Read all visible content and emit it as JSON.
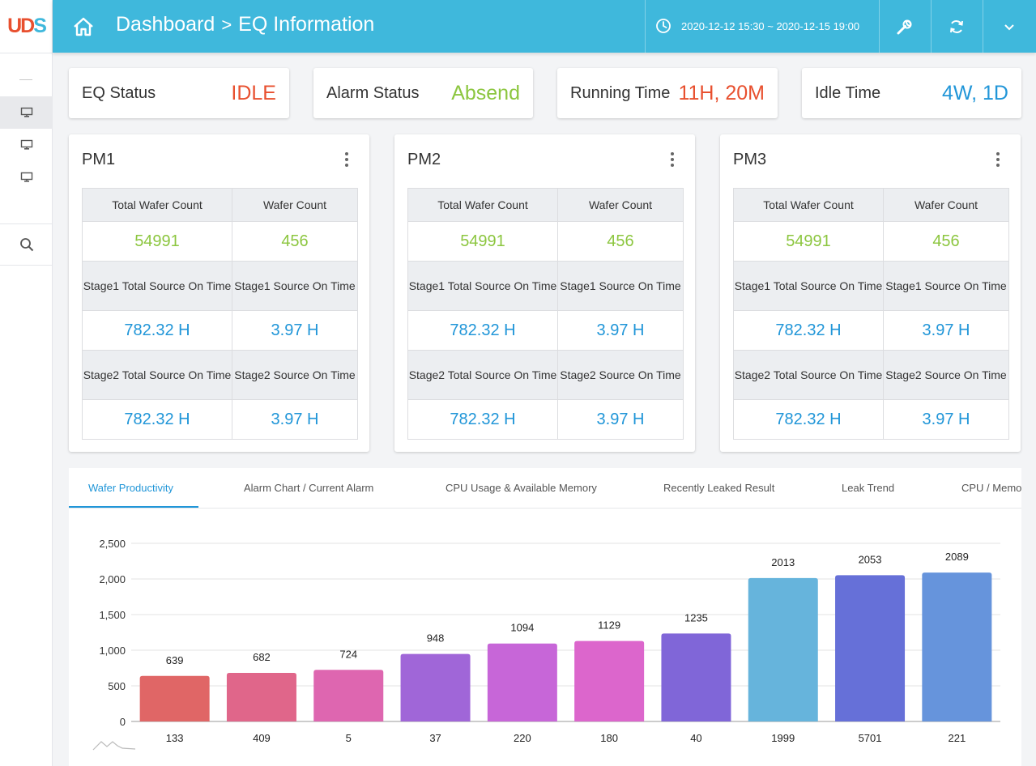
{
  "sidebar": {
    "logo": "UDS",
    "items": [
      {
        "icon": "monitor-icon",
        "active": true
      },
      {
        "icon": "monitor-icon",
        "active": false
      },
      {
        "icon": "monitor-icon",
        "active": false
      }
    ],
    "search_icon": "search-icon"
  },
  "header": {
    "crumb_root": "Dashboard",
    "crumb_separator": ">",
    "crumb_current": "EQ Information",
    "time_range": "2020-12-12 15:30 ~ 2020-12-15 19:00",
    "icons": [
      "home-icon",
      "clock-icon",
      "wrench-icon",
      "refresh-icon",
      "chevron-down-icon"
    ]
  },
  "status": [
    {
      "label": "EQ Status",
      "value": "IDLE",
      "color": "#e8502f"
    },
    {
      "label": "Alarm Status",
      "value": "Absend",
      "color": "#8cc63f"
    },
    {
      "label": "Running Time",
      "value": "11H, 20M",
      "color": "#e8502f"
    },
    {
      "label": "Idle Time",
      "value": "4W, 1D",
      "color": "#2196d8"
    }
  ],
  "pm_cards": [
    {
      "title": "PM1",
      "headers": [
        "Total Wafer Count",
        "Wafer Count",
        "Stage1 Total Source On Time",
        "Stage1 Source On Time",
        "Stage2 Total Source On Time",
        "Stage2 Source On Time"
      ],
      "values": [
        "54991",
        "456",
        "782.32 H",
        "3.97 H",
        "782.32 H",
        "3.97 H"
      ]
    },
    {
      "title": "PM2",
      "headers": [
        "Total Wafer Count",
        "Wafer Count",
        "Stage1 Total Source On Time",
        "Stage1 Source On Time",
        "Stage2 Total Source On Time",
        "Stage2 Source On Time"
      ],
      "values": [
        "54991",
        "456",
        "782.32 H",
        "3.97 H",
        "782.32 H",
        "3.97 H"
      ]
    },
    {
      "title": "PM3",
      "headers": [
        "Total Wafer Count",
        "Wafer Count",
        "Stage1 Total Source On Time",
        "Stage1 Source On Time",
        "Stage2 Total Source On Time",
        "Stage2 Source On Time"
      ],
      "values": [
        "54991",
        "456",
        "782.32 H",
        "3.97 H",
        "782.32 H",
        "3.97 H"
      ]
    }
  ],
  "tabs": [
    "Wafer Productivity",
    "Alarm Chart / Current Alarm",
    "CPU Usage & Available Memory",
    "Recently Leaked Result",
    "Leak Trend",
    "CPU / Memo"
  ],
  "active_tab": 0,
  "colors": {
    "header": "#3fb8dc",
    "accent": "#2196d8",
    "green": "#8cc63f",
    "red": "#e8502f"
  },
  "chart_data": {
    "type": "bar",
    "categories": [
      "133",
      "409",
      "5",
      "37",
      "220",
      "180",
      "40",
      "1999",
      "5701",
      "221"
    ],
    "values": [
      639,
      682,
      724,
      948,
      1094,
      1129,
      1235,
      2013,
      2053,
      2089
    ],
    "bar_colors": [
      "#e06666",
      "#e0668a",
      "#de66b0",
      "#a066d8",
      "#c766d8",
      "#dc66cc",
      "#8066d8",
      "#66b4dc",
      "#6670d8",
      "#6694dc"
    ],
    "ylim": [
      0,
      2500
    ],
    "yticks": [
      "0",
      "500",
      "1,000",
      "1,500",
      "2,000",
      "2,500"
    ],
    "grid": true
  }
}
